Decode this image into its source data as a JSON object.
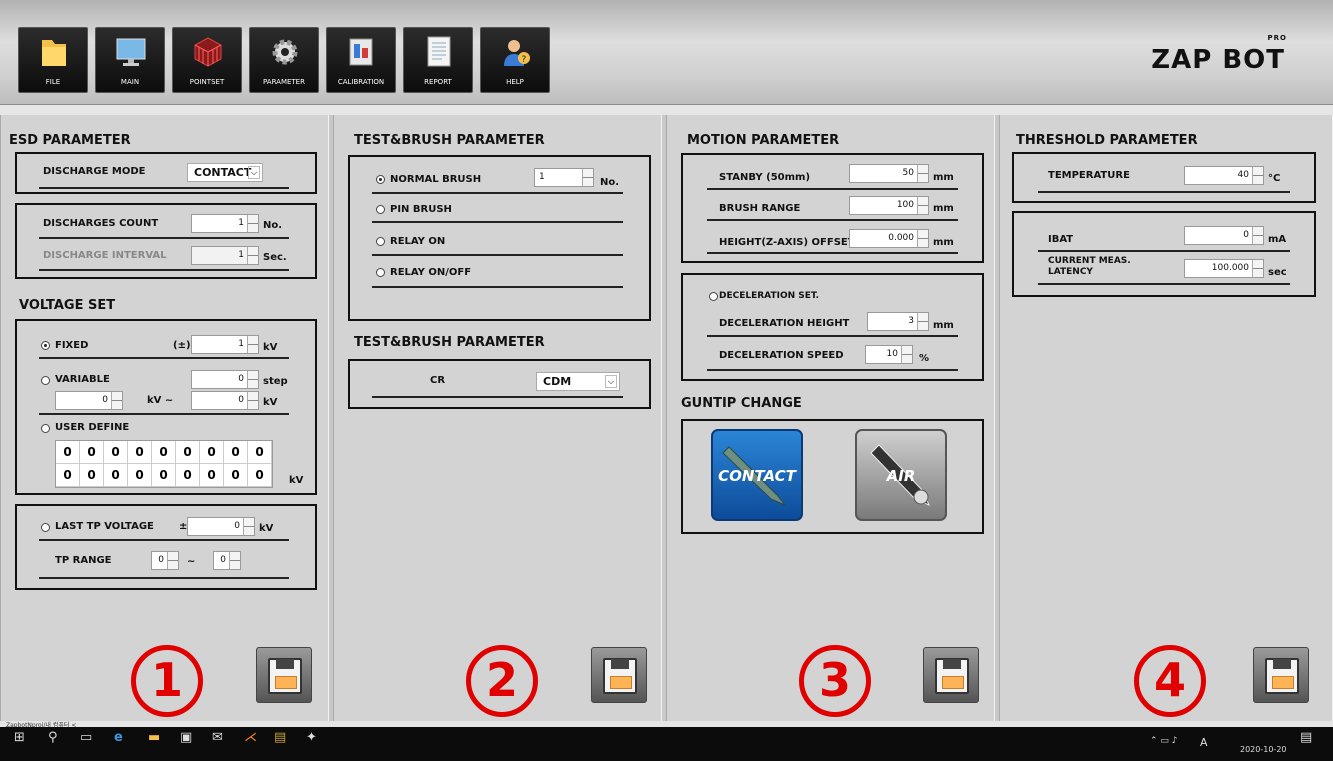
{
  "toolbar": {
    "buttons": [
      {
        "label": "FILE",
        "icon": "folder-icon"
      },
      {
        "label": "MAIN",
        "icon": "monitor-icon"
      },
      {
        "label": "POINTSET",
        "icon": "grid-icon"
      },
      {
        "label": "PARAMETER",
        "icon": "gear-icon"
      },
      {
        "label": "CALIBRATION",
        "icon": "calibration-icon"
      },
      {
        "label": "REPORT",
        "icon": "report-icon"
      },
      {
        "label": "HELP",
        "icon": "help-icon"
      }
    ],
    "logo": "ZAP BOT",
    "logo_badge": "PRO"
  },
  "panel1": {
    "esd": {
      "title": "ESD PARAMETER",
      "discharge_mode_label": "DISCHARGE MODE",
      "discharge_mode_value": "CONTACT",
      "discharges_count_label": "DISCHARGES COUNT",
      "discharges_count_value": "1",
      "discharges_count_unit": "No.",
      "discharge_interval_label": "DISCHARGE INTERVAL",
      "discharge_interval_value": "1",
      "discharge_interval_unit": "Sec."
    },
    "voltage": {
      "title": "VOLTAGE SET",
      "fixed_label": "FIXED",
      "fixed_sign": "(±)",
      "fixed_value": "1",
      "fixed_unit": "kV",
      "variable_label": "VARIABLE",
      "variable_step_value": "0",
      "variable_step_unit": "step",
      "variable_from": "0",
      "variable_mid_unit": "kV ~",
      "variable_to": "0",
      "variable_unit": "kV",
      "user_define_label": "USER DEFINE",
      "user_define_values": [
        "0",
        "0",
        "0",
        "0",
        "0",
        "0",
        "0",
        "0",
        "0",
        "0",
        "0",
        "0",
        "0",
        "0",
        "0",
        "0",
        "0",
        "0"
      ],
      "user_define_unit": "kV",
      "last_tp_label": "LAST TP VOLTAGE",
      "last_tp_sign": "±",
      "last_tp_value": "0",
      "last_tp_unit": "kV",
      "tp_range_label": "TP RANGE",
      "tp_range_from": "0",
      "tp_range_sep": "~",
      "tp_range_to": "0"
    },
    "number": "1"
  },
  "panel2": {
    "brush": {
      "title": "TEST&BRUSH PARAMETER",
      "normal_brush": "NORMAL BRUSH",
      "normal_brush_value": "1",
      "normal_brush_unit": "No.",
      "pin_brush": "PIN BRUSH",
      "relay_on": "RELAY ON",
      "relay_onoff": "RELAY ON/OFF"
    },
    "brush2": {
      "title": "TEST&BRUSH PARAMETER",
      "cr_label": "CR",
      "cr_value": "CDM"
    },
    "number": "2"
  },
  "panel3": {
    "motion": {
      "title": "MOTION PARAMETER",
      "stanby_label": "STANBY (50mm)",
      "stanby_value": "50",
      "stanby_unit": "mm",
      "brush_range_label": "BRUSH RANGE",
      "brush_range_value": "100",
      "brush_range_unit": "mm",
      "height_offset_label": "HEIGHT(Z-AXIS) OFFSET",
      "height_offset_value": "0.000",
      "height_offset_unit": "mm",
      "decel_set_label": "DECELERATION SET.",
      "decel_height_label": "DECELERATION HEIGHT",
      "decel_height_value": "3",
      "decel_height_unit": "mm",
      "decel_speed_label": "DECELERATION SPEED",
      "decel_speed_value": "10",
      "decel_speed_unit": "%"
    },
    "guntip": {
      "title": "GUNTIP CHANGE",
      "contact": "CONTACT",
      "air": "AIR"
    },
    "number": "3"
  },
  "panel4": {
    "threshold": {
      "title": "THRESHOLD PARAMETER",
      "temperature_label": "TEMPERATURE",
      "temperature_value": "40",
      "temperature_unit": "°C",
      "ibat_label": "IBAT",
      "ibat_value": "0",
      "ibat_unit": "mA",
      "latency_label_1": "CURRENT MEAS.",
      "latency_label_2": "LATENCY",
      "latency_value": "100.000",
      "latency_unit": "sec"
    },
    "number": "4"
  },
  "statusbar": {
    "path": "ZapbotNproj/내 컴퓨터 <"
  },
  "taskbar": {
    "date": "2020-10-20",
    "lang": "A"
  },
  "colors": {
    "marker": "#e00000",
    "contact_blue": "#1565c0"
  }
}
